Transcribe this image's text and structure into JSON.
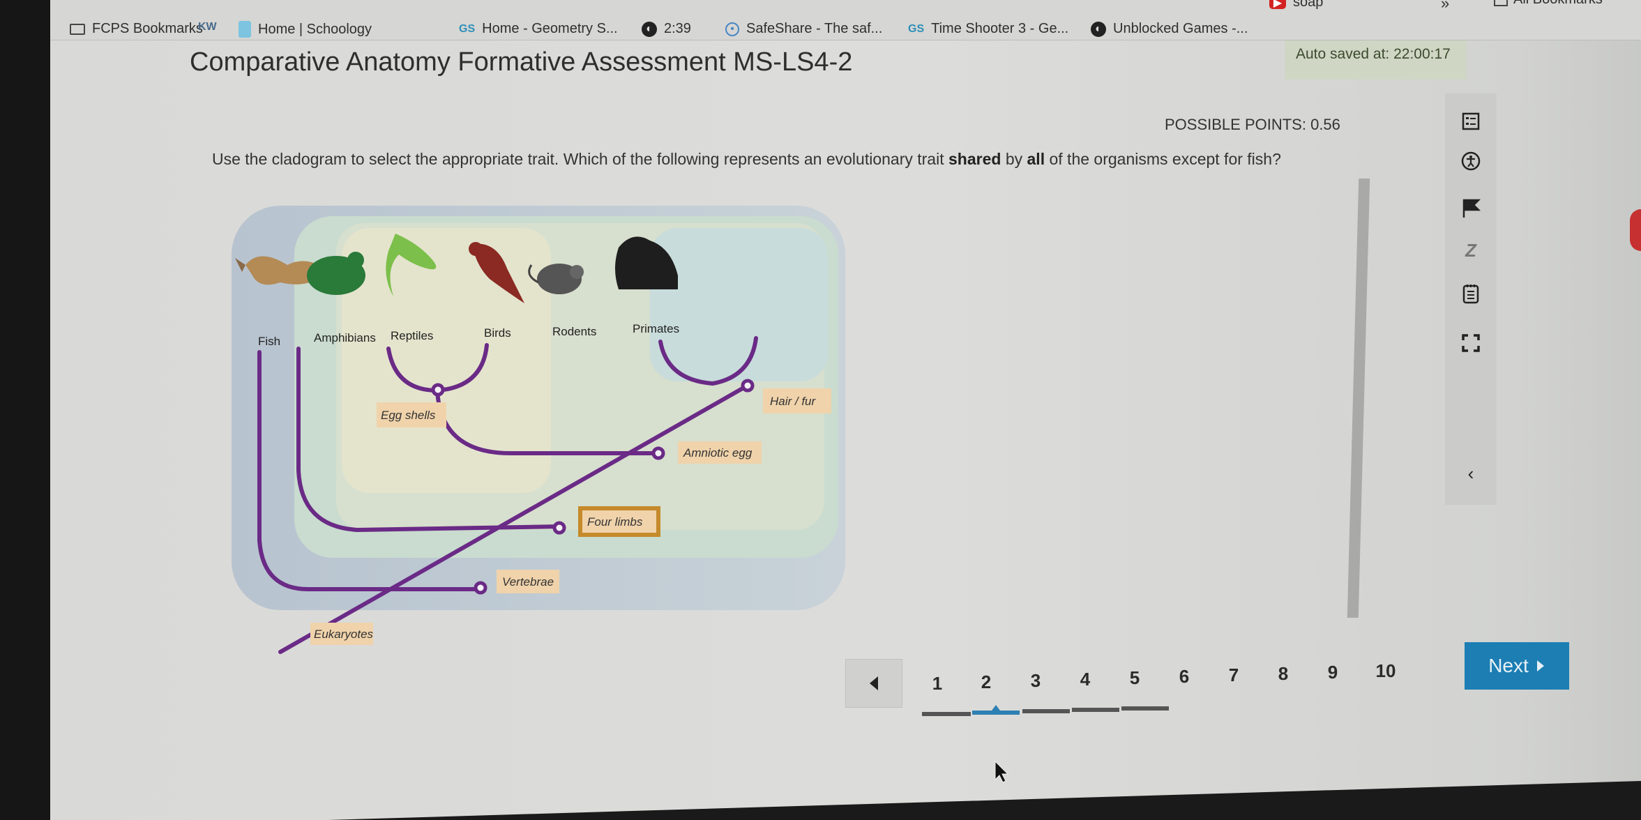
{
  "browser": {
    "bookmarks": [
      {
        "label": "FCPS Bookmarks",
        "icon": "folder-icon"
      },
      {
        "label": "",
        "icon": "app-icon"
      },
      {
        "label": "Home | Schoology",
        "icon": "schoology-icon"
      },
      {
        "label": "Home - Geometry S...",
        "icon": "gs-icon"
      },
      {
        "label": "2:39",
        "icon": "globe-icon"
      },
      {
        "label": "SafeShare - The saf...",
        "icon": "safeshare-icon"
      },
      {
        "label": "Time Shooter 3 - Ge...",
        "icon": "gs-icon"
      },
      {
        "label": "Unblocked Games -...",
        "icon": "globe-icon"
      },
      {
        "label": "soap",
        "icon": "youtube-icon"
      }
    ],
    "overflow_label": "»",
    "all_bookmarks_label": "All Bookmarks"
  },
  "assessment": {
    "title": "Comparative Anatomy Formative Assessment MS-LS4-2",
    "autosave_label": "Auto saved at:",
    "autosave_time": "22:00:17",
    "possible_points_label": "POSSIBLE POINTS:",
    "possible_points_value": "0.56",
    "question_part1": "Use the cladogram to select the appropriate trait. Which of the following represents an evolutionary trait ",
    "question_bold1": "shared",
    "question_part2": " by ",
    "question_bold2": "all",
    "question_part3": " of the organisms except for fish?"
  },
  "cladogram": {
    "organisms": [
      "Fish",
      "Amphibians",
      "Reptiles",
      "Birds",
      "Rodents",
      "Primates"
    ],
    "traits": [
      "Eukaryotes",
      "Vertebrae",
      "Four limbs",
      "Amniotic egg",
      "Egg shells",
      "Hair / fur"
    ],
    "highlighted_trait": "Four limbs",
    "colors": {
      "branch": "#6a2a86",
      "label_bg": "#f0d3ab",
      "highlight_border": "#c58a2a"
    }
  },
  "toolbar": {
    "tools": [
      {
        "name": "item-overview",
        "icon": "list-icon"
      },
      {
        "name": "accessibility",
        "icon": "accessibility-icon"
      },
      {
        "name": "flag",
        "icon": "flag-icon"
      },
      {
        "name": "answer-eliminator",
        "icon": "eliminator-icon"
      },
      {
        "name": "notepad",
        "icon": "notepad-icon"
      },
      {
        "name": "fullscreen",
        "icon": "fullscreen-icon"
      },
      {
        "name": "collapse",
        "icon": "chevron-left-icon"
      }
    ]
  },
  "pagination": {
    "pages": [
      "1",
      "2",
      "3",
      "4",
      "5",
      "6",
      "7",
      "8",
      "9",
      "10"
    ],
    "current_page": "2",
    "answered_pages": [
      "1",
      "2",
      "3",
      "4",
      "5"
    ],
    "next_label": "Next",
    "accent_color": "#1c7eb3"
  }
}
